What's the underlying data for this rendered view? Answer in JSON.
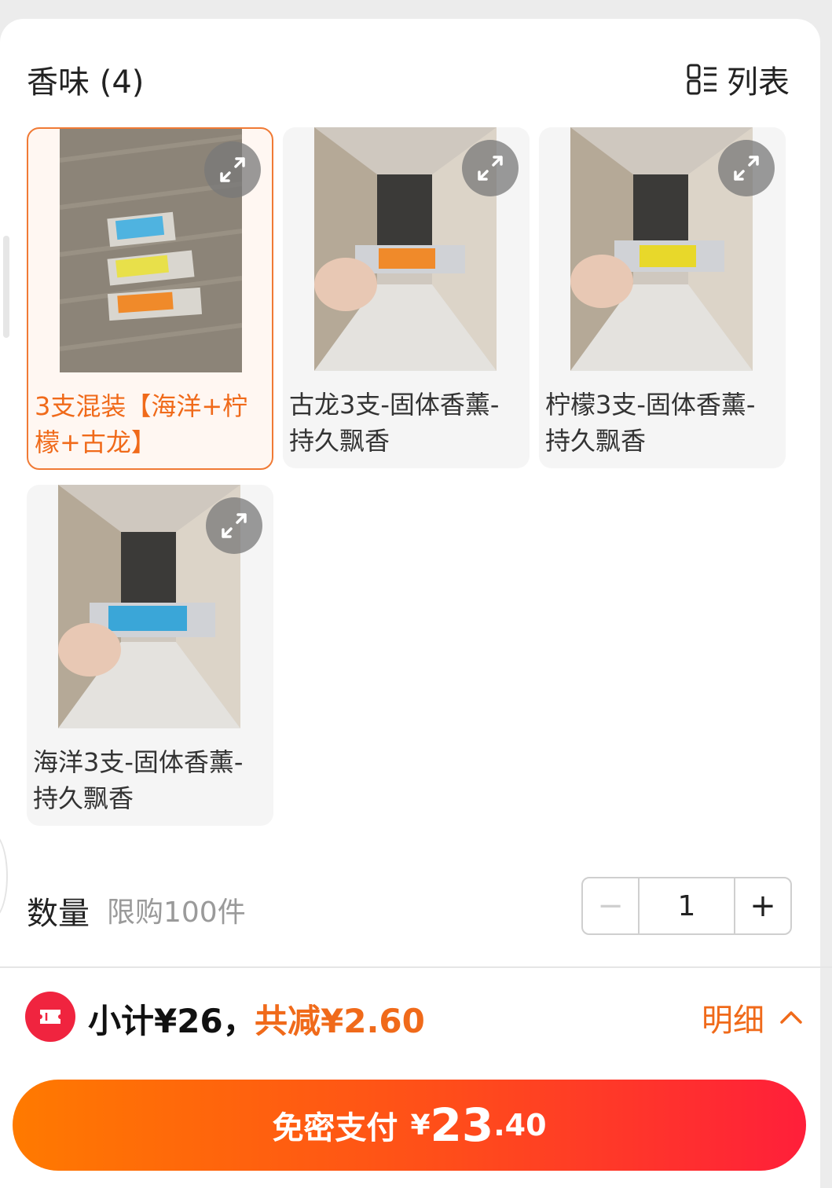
{
  "header": {
    "title": "香味 (4)",
    "view_toggle_label": "列表"
  },
  "options": [
    {
      "label": "3支混装【海洋+柠檬+古龙】",
      "selected": true,
      "packet_colors": [
        "#4fb3e0",
        "#e8e04a",
        "#f08a2a"
      ]
    },
    {
      "label": "古龙3支-固体香薰-持久飘香",
      "selected": false,
      "packet_color": "#f08a2a"
    },
    {
      "label": "柠檬3支-固体香薰-持久飘香",
      "selected": false,
      "packet_color": "#e8d82a"
    },
    {
      "label": "海洋3支-固体香薰-持久飘香",
      "selected": false,
      "packet_color": "#3aa6d8"
    }
  ],
  "quantity": {
    "label": "数量",
    "limit_text": "限购100件",
    "value": "1",
    "minus": "−",
    "plus": "+"
  },
  "summary": {
    "subtotal": "小计¥26，",
    "discount": "共减¥2.60",
    "detail_label": "明细"
  },
  "pay": {
    "label": "免密支付",
    "currency": "¥",
    "amount_int": "23",
    "amount_dec": ".40"
  },
  "colors": {
    "accent": "#f06a1a",
    "coupon": "#f0243f"
  }
}
